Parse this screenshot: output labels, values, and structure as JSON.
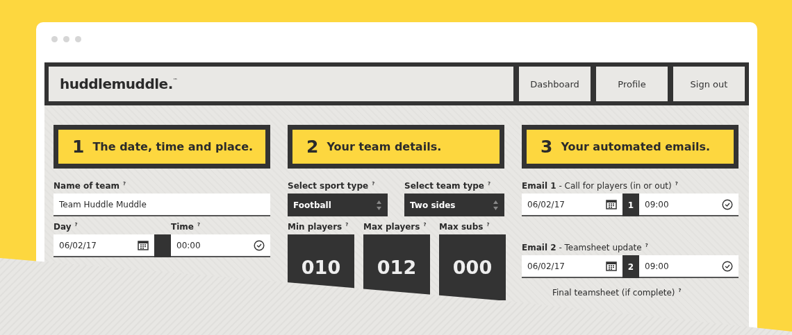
{
  "header": {
    "logo": "huddlemuddle.",
    "trademark": "™",
    "nav": [
      {
        "label": "Dashboard"
      },
      {
        "label": "Profile"
      },
      {
        "label": "Sign out"
      }
    ]
  },
  "sections": [
    {
      "number": "1",
      "title": "The date, time and place."
    },
    {
      "number": "2",
      "title": "Your team details."
    },
    {
      "number": "3",
      "title": "Your automated emails."
    }
  ],
  "place": {
    "team_name": {
      "label": "Name of team",
      "help": "?",
      "value": "Team Huddle Muddle"
    },
    "day": {
      "label": "Day",
      "help": "?",
      "value": "06/02/17"
    },
    "time": {
      "label": "Time",
      "help": "?",
      "value": "00:00"
    }
  },
  "team": {
    "selects": [
      {
        "label": "Select sport type",
        "help": "?",
        "value": "Football"
      },
      {
        "label": "Select team type",
        "help": "?",
        "value": "Two sides"
      }
    ],
    "counters": [
      {
        "label": "Min players",
        "help": "?",
        "value": "010"
      },
      {
        "label": "Max players",
        "help": "?",
        "value": "012"
      },
      {
        "label": "Max subs",
        "help": "?",
        "value": "000"
      }
    ]
  },
  "emails": [
    {
      "label": "**Email 1** - Call for players (in or out)",
      "help": "?",
      "date": "06/02/17",
      "number": "1",
      "time": "09:00"
    },
    {
      "label": "**Email 2** - Teamsheet update",
      "help": "?",
      "date": "06/02/17",
      "number": "2",
      "time": "09:00"
    }
  ],
  "email_partial": {
    "label": "Final teamsheet (if complete)",
    "help": "?"
  }
}
